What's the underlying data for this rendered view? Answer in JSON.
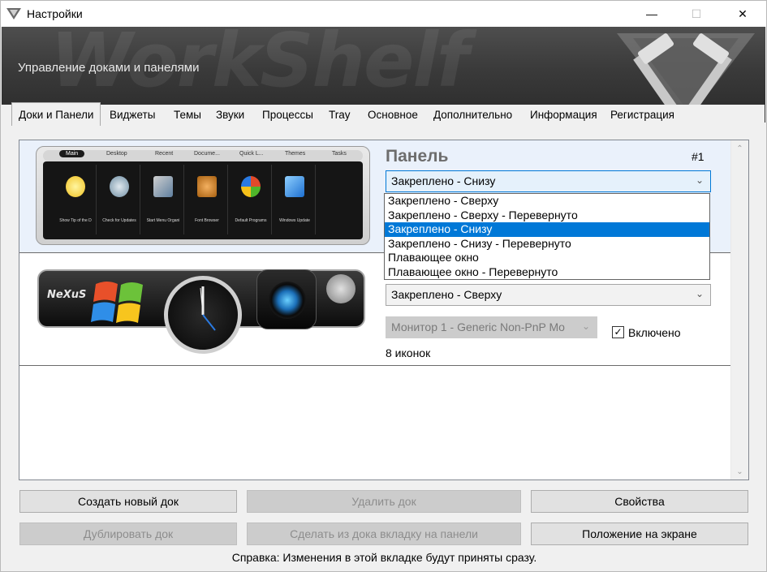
{
  "window": {
    "title": "Настройки",
    "controls": {
      "minimize": "—",
      "maximize": "☐",
      "close": "✕"
    }
  },
  "banner": {
    "watermark": "WorkShelf",
    "subtitle": "Управление доками и панелями"
  },
  "tabs": [
    {
      "label": "Доки и Панели",
      "active": true
    },
    {
      "label": "Виджеты"
    },
    {
      "label": "Темы"
    },
    {
      "label": "Звуки"
    },
    {
      "label": "Процессы"
    },
    {
      "label": "Tray"
    },
    {
      "label": "Основное"
    },
    {
      "label": "Дополнительно"
    },
    {
      "label": "Информация"
    },
    {
      "label": "Регистрация"
    }
  ],
  "dock1": {
    "preview_tabs": [
      "Main",
      "Desktop",
      "Recent",
      "Docume...",
      "Quick L...",
      "Themes",
      "Tasks"
    ],
    "preview_items": [
      "Show Tip of the D",
      "Check for Updates",
      "Start Menu Organi",
      "Font Browser",
      "Default Programs",
      "Windows Update"
    ]
  },
  "panel": {
    "title": "Панель",
    "number": "#1",
    "position_select": "Закреплено - Снизу",
    "position_options": [
      "Закреплено - Сверху",
      "Закреплено - Сверху - Перевернуто",
      "Закреплено - Снизу",
      "Закреплено - Снизу - Перевернуто",
      "Плавающее окно",
      "Плавающее окно - Перевернуто"
    ],
    "selected_option_index": 2
  },
  "dock2": {
    "preview_logo": "NeXuS",
    "position_select": "Закреплено - Сверху",
    "monitor_select": "Монитор 1 - Generic Non-PnP Mo",
    "enabled_label": "Включено",
    "enabled": true,
    "icons_count": "8 иконок"
  },
  "buttons": {
    "create": "Создать новый док",
    "delete": "Удалить док",
    "properties": "Свойства",
    "duplicate": "Дублировать док",
    "make_tab": "Сделать из дока вкладку на панели",
    "screen_position": "Положение на экране"
  },
  "help_text": "Справка: Изменения в этой вкладке будут приняты сразу.",
  "colors": {
    "selection": "#0078d7",
    "banner": "#3a3a3a",
    "panel_title": "#6d6d6d"
  }
}
